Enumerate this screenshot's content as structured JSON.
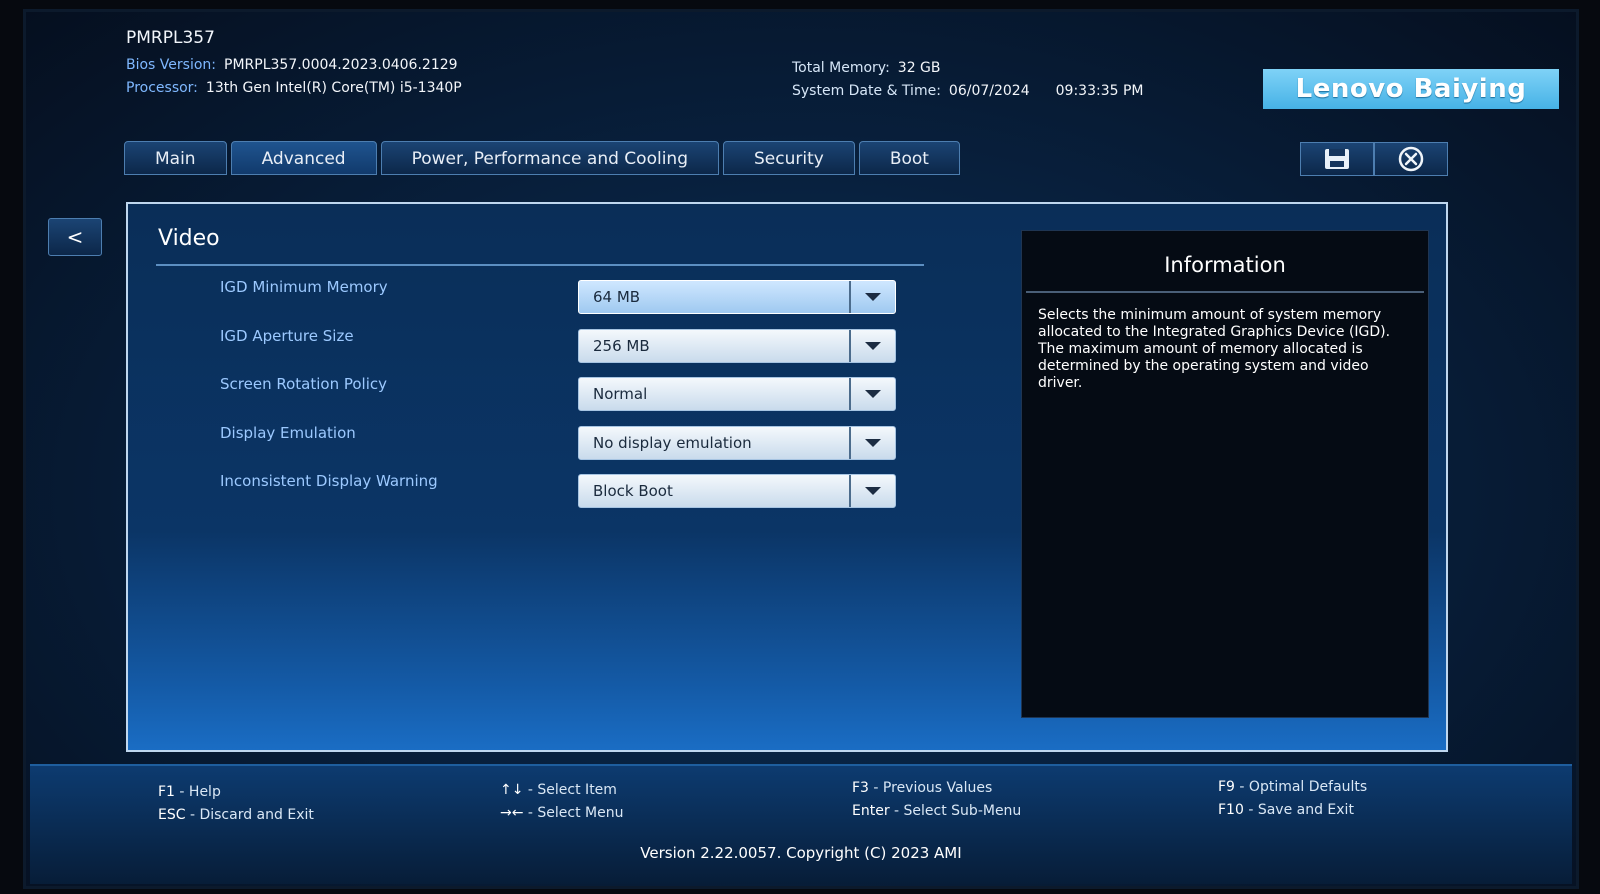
{
  "header": {
    "model": "PMRPL357",
    "bios_label": "Bios Version:",
    "bios_value": "PMRPL357.0004.2023.0406.2129",
    "processor_label": "Processor:",
    "processor_value": "13th Gen Intel(R) Core(TM) i5-1340P",
    "memory_label": "Total Memory:",
    "memory_value": "32 GB",
    "datetime_label": "System Date & Time:",
    "date_value": "06/07/2024",
    "time_value": "09:33:35 PM",
    "logo": "Lenovo Baiying"
  },
  "tabs": [
    {
      "label": "Main"
    },
    {
      "label": "Advanced",
      "active": true
    },
    {
      "label": "Power, Performance and Cooling"
    },
    {
      "label": "Security"
    },
    {
      "label": "Boot"
    }
  ],
  "toolbar": {
    "save_icon": "floppy-save-icon",
    "exit_icon": "circle-x-icon"
  },
  "back_label": "<",
  "section": {
    "title": "Video",
    "settings": [
      {
        "label": "IGD Minimum Memory",
        "value": "64 MB",
        "focused": true
      },
      {
        "label": "IGD Aperture Size",
        "value": "256 MB"
      },
      {
        "label": "Screen Rotation Policy",
        "value": "Normal"
      },
      {
        "label": "Display Emulation",
        "value": "No display emulation"
      },
      {
        "label": "Inconsistent Display Warning",
        "value": "Block Boot"
      }
    ]
  },
  "info": {
    "title": "Information",
    "line1": "Selects the minimum amount of system memory allocated to the Integrated Graphics Device (IGD).",
    "line2": "The maximum amount of memory allocated is determined by the operating system and video driver."
  },
  "footer": {
    "f1_key": "F1",
    "f1_text": " - Help",
    "esc_key": "ESC",
    "esc_text": " - Discard and Exit",
    "updown_key": "↑↓",
    "updown_text": " - Select Item",
    "leftright_key": "→←",
    "leftright_text": " - Select Menu",
    "f3_key": "F3",
    "f3_text": " - Previous Values",
    "enter_key": "Enter",
    "enter_text": " - Select Sub-Menu",
    "f9_key": "F9",
    "f9_text": " - Optimal Defaults",
    "f10_key": "F10",
    "f10_text": " - Save and Exit",
    "version": "Version 2.22.0057. Copyright (C) 2023 AMI"
  }
}
